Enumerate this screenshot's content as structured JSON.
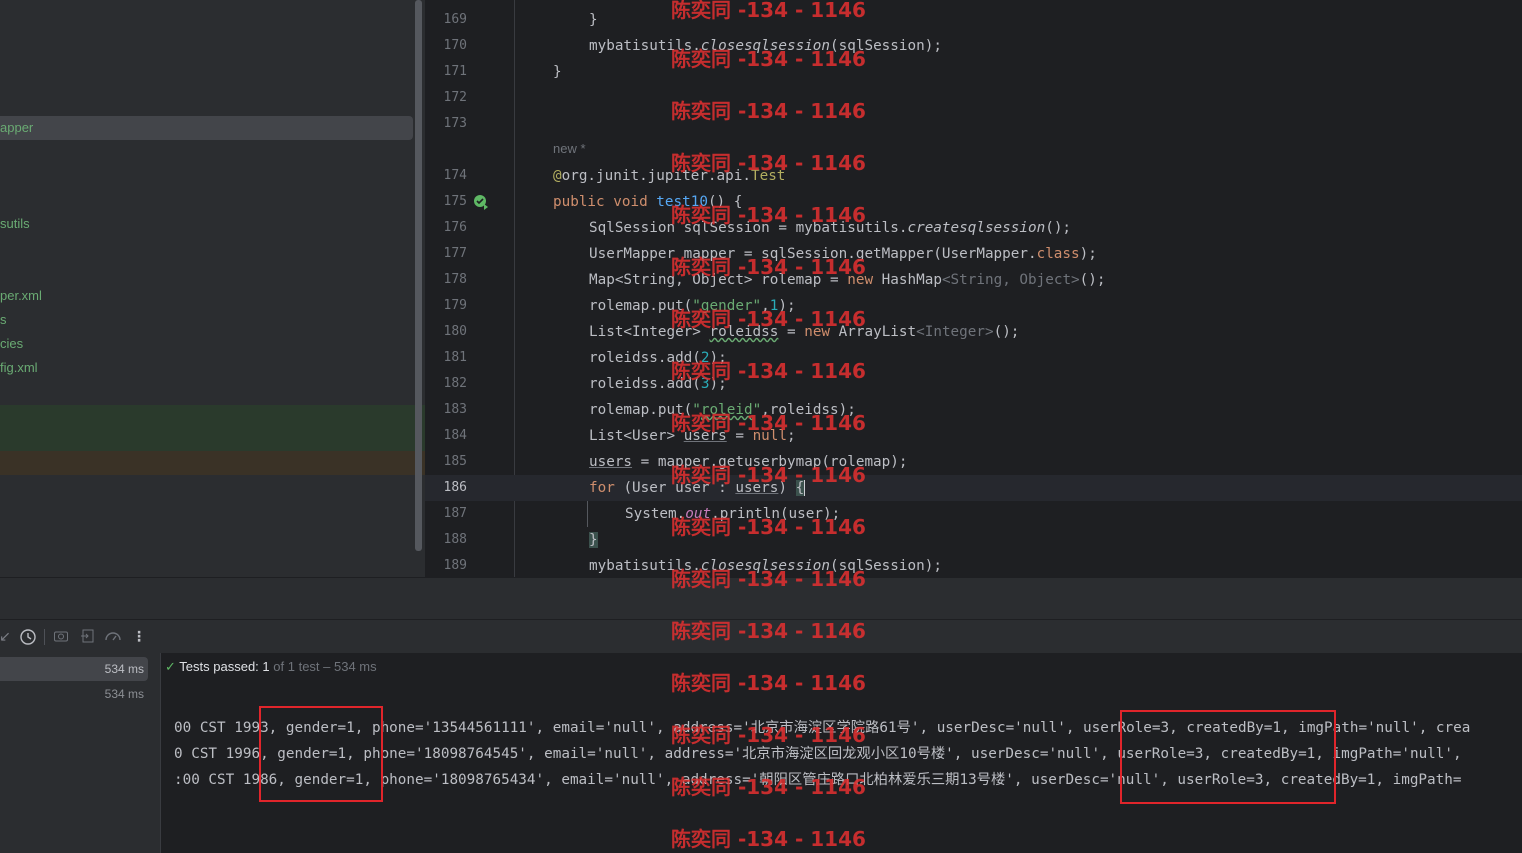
{
  "project_tree": {
    "items": [
      "apper",
      "sutils",
      "per.xml",
      "s",
      "cies",
      "fig.xml"
    ]
  },
  "editor": {
    "inlay_new": "new *",
    "lines": [
      {
        "num": "169"
      },
      {
        "num": "170"
      },
      {
        "num": "171"
      },
      {
        "num": "172"
      },
      {
        "num": "173"
      },
      {
        "num": "174"
      },
      {
        "num": "175"
      },
      {
        "num": "176"
      },
      {
        "num": "177"
      },
      {
        "num": "178"
      },
      {
        "num": "179"
      },
      {
        "num": "180"
      },
      {
        "num": "181"
      },
      {
        "num": "182"
      },
      {
        "num": "183"
      },
      {
        "num": "184"
      },
      {
        "num": "185"
      },
      {
        "num": "186"
      },
      {
        "num": "187"
      },
      {
        "num": "188"
      },
      {
        "num": "189"
      }
    ],
    "current_line": "186"
  },
  "run": {
    "status_label": "Tests passed:",
    "status_count": "1",
    "status_rest": "of 1 test – 534 ms",
    "time_total": "534 ms",
    "time_test": "534 ms"
  },
  "console": {
    "lines": [
      "00 CST 1993, gender=1, phone='13544561111', email='null', address='北京市海淀区学院路61号', userDesc='null', userRole=3, createdBy=1, imgPath='null', crea",
      "0 CST 1996, gender=1, phone='18098764545', email='null', address='北京市海淀区回龙观小区10号楼', userDesc='null', userRole=3, createdBy=1, imgPath='null', ",
      ":00 CST 1986, gender=1, phone='18098765434', email='null', address='朝阳区管庄路口北柏林爱乐三期13号楼', userDesc='null', userRole=3, createdBy=1, imgPath="
    ]
  },
  "watermark": "陈奕同 -134 - 1146",
  "colors": {
    "keyword": "#cf8e6d",
    "function": "#56a8f5",
    "string": "#6aab73",
    "number": "#2aacb8",
    "annotation": "#b3ae60",
    "highlight_box": "#e0252b",
    "watermark": "#de3030"
  }
}
